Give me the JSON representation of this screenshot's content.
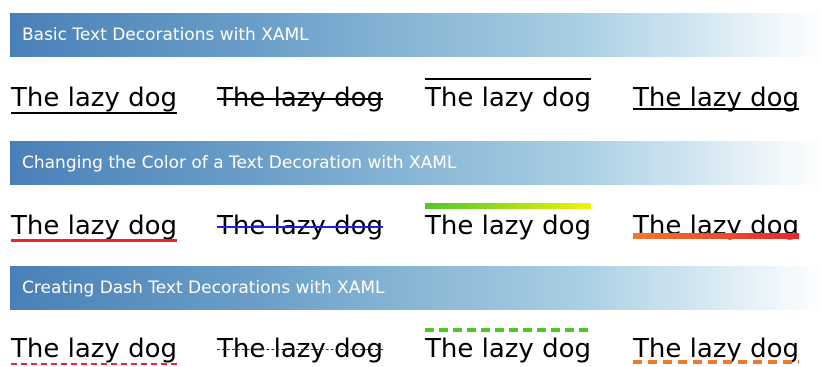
{
  "sections": [
    {
      "title": "Basic Text Decorations with XAML"
    },
    {
      "title": "Changing the Color of a Text Decoration with XAML"
    },
    {
      "title": "Creating Dash Text Decorations with XAML"
    }
  ],
  "sample_text": "The lazy dog",
  "colors": {
    "header_gradient_start": "#4a80b8",
    "header_gradient_end": "#ffffff",
    "header_text": "#ffffff",
    "red": "#e8262c",
    "blue": "#1e1ee8",
    "yellow_green_start": "#4cc82a",
    "yellow_green_end": "#f2f20a",
    "orange": "#f07830",
    "orange_red": "#e8262c"
  }
}
